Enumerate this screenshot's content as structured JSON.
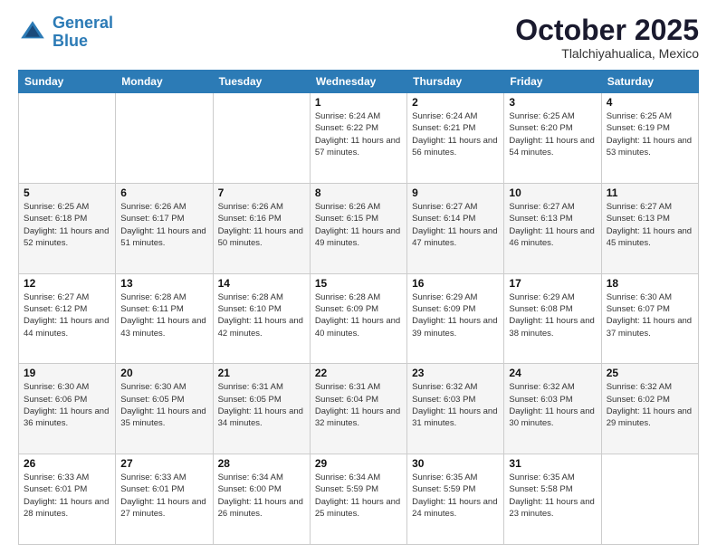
{
  "header": {
    "logo_line1": "General",
    "logo_line2": "Blue",
    "month": "October 2025",
    "location": "Tlalchiyahualica, Mexico"
  },
  "weekdays": [
    "Sunday",
    "Monday",
    "Tuesday",
    "Wednesday",
    "Thursday",
    "Friday",
    "Saturday"
  ],
  "weeks": [
    [
      {
        "day": "",
        "info": ""
      },
      {
        "day": "",
        "info": ""
      },
      {
        "day": "",
        "info": ""
      },
      {
        "day": "1",
        "info": "Sunrise: 6:24 AM\nSunset: 6:22 PM\nDaylight: 11 hours and 57 minutes."
      },
      {
        "day": "2",
        "info": "Sunrise: 6:24 AM\nSunset: 6:21 PM\nDaylight: 11 hours and 56 minutes."
      },
      {
        "day": "3",
        "info": "Sunrise: 6:25 AM\nSunset: 6:20 PM\nDaylight: 11 hours and 54 minutes."
      },
      {
        "day": "4",
        "info": "Sunrise: 6:25 AM\nSunset: 6:19 PM\nDaylight: 11 hours and 53 minutes."
      }
    ],
    [
      {
        "day": "5",
        "info": "Sunrise: 6:25 AM\nSunset: 6:18 PM\nDaylight: 11 hours and 52 minutes."
      },
      {
        "day": "6",
        "info": "Sunrise: 6:26 AM\nSunset: 6:17 PM\nDaylight: 11 hours and 51 minutes."
      },
      {
        "day": "7",
        "info": "Sunrise: 6:26 AM\nSunset: 6:16 PM\nDaylight: 11 hours and 50 minutes."
      },
      {
        "day": "8",
        "info": "Sunrise: 6:26 AM\nSunset: 6:15 PM\nDaylight: 11 hours and 49 minutes."
      },
      {
        "day": "9",
        "info": "Sunrise: 6:27 AM\nSunset: 6:14 PM\nDaylight: 11 hours and 47 minutes."
      },
      {
        "day": "10",
        "info": "Sunrise: 6:27 AM\nSunset: 6:13 PM\nDaylight: 11 hours and 46 minutes."
      },
      {
        "day": "11",
        "info": "Sunrise: 6:27 AM\nSunset: 6:13 PM\nDaylight: 11 hours and 45 minutes."
      }
    ],
    [
      {
        "day": "12",
        "info": "Sunrise: 6:27 AM\nSunset: 6:12 PM\nDaylight: 11 hours and 44 minutes."
      },
      {
        "day": "13",
        "info": "Sunrise: 6:28 AM\nSunset: 6:11 PM\nDaylight: 11 hours and 43 minutes."
      },
      {
        "day": "14",
        "info": "Sunrise: 6:28 AM\nSunset: 6:10 PM\nDaylight: 11 hours and 42 minutes."
      },
      {
        "day": "15",
        "info": "Sunrise: 6:28 AM\nSunset: 6:09 PM\nDaylight: 11 hours and 40 minutes."
      },
      {
        "day": "16",
        "info": "Sunrise: 6:29 AM\nSunset: 6:09 PM\nDaylight: 11 hours and 39 minutes."
      },
      {
        "day": "17",
        "info": "Sunrise: 6:29 AM\nSunset: 6:08 PM\nDaylight: 11 hours and 38 minutes."
      },
      {
        "day": "18",
        "info": "Sunrise: 6:30 AM\nSunset: 6:07 PM\nDaylight: 11 hours and 37 minutes."
      }
    ],
    [
      {
        "day": "19",
        "info": "Sunrise: 6:30 AM\nSunset: 6:06 PM\nDaylight: 11 hours and 36 minutes."
      },
      {
        "day": "20",
        "info": "Sunrise: 6:30 AM\nSunset: 6:05 PM\nDaylight: 11 hours and 35 minutes."
      },
      {
        "day": "21",
        "info": "Sunrise: 6:31 AM\nSunset: 6:05 PM\nDaylight: 11 hours and 34 minutes."
      },
      {
        "day": "22",
        "info": "Sunrise: 6:31 AM\nSunset: 6:04 PM\nDaylight: 11 hours and 32 minutes."
      },
      {
        "day": "23",
        "info": "Sunrise: 6:32 AM\nSunset: 6:03 PM\nDaylight: 11 hours and 31 minutes."
      },
      {
        "day": "24",
        "info": "Sunrise: 6:32 AM\nSunset: 6:03 PM\nDaylight: 11 hours and 30 minutes."
      },
      {
        "day": "25",
        "info": "Sunrise: 6:32 AM\nSunset: 6:02 PM\nDaylight: 11 hours and 29 minutes."
      }
    ],
    [
      {
        "day": "26",
        "info": "Sunrise: 6:33 AM\nSunset: 6:01 PM\nDaylight: 11 hours and 28 minutes."
      },
      {
        "day": "27",
        "info": "Sunrise: 6:33 AM\nSunset: 6:01 PM\nDaylight: 11 hours and 27 minutes."
      },
      {
        "day": "28",
        "info": "Sunrise: 6:34 AM\nSunset: 6:00 PM\nDaylight: 11 hours and 26 minutes."
      },
      {
        "day": "29",
        "info": "Sunrise: 6:34 AM\nSunset: 5:59 PM\nDaylight: 11 hours and 25 minutes."
      },
      {
        "day": "30",
        "info": "Sunrise: 6:35 AM\nSunset: 5:59 PM\nDaylight: 11 hours and 24 minutes."
      },
      {
        "day": "31",
        "info": "Sunrise: 6:35 AM\nSunset: 5:58 PM\nDaylight: 11 hours and 23 minutes."
      },
      {
        "day": "",
        "info": ""
      }
    ]
  ]
}
